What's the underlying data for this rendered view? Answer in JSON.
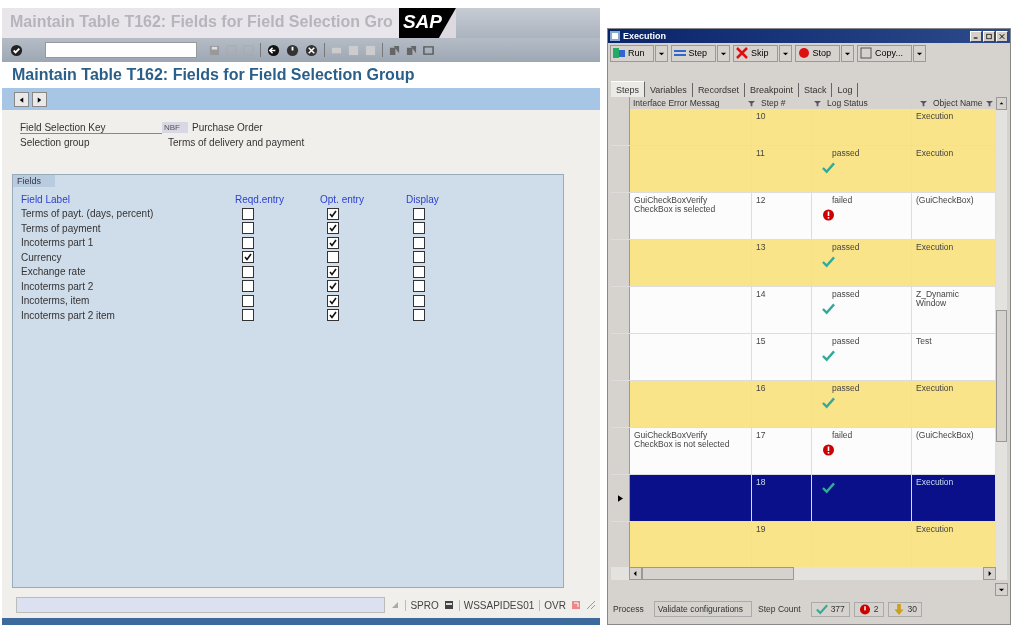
{
  "sap_window": {
    "title": "Maintain Table T162: Fields for Field Selection Gro",
    "logo": "SAP",
    "heading": "Maintain Table T162: Fields for Field Selection Group",
    "key_fields": [
      {
        "label": "Field Selection Key",
        "code": "NBF",
        "value": "Purchase Order"
      },
      {
        "label": "Selection group",
        "value": "Terms of delivery and payment"
      }
    ],
    "group_title": "Fields",
    "columns": [
      "Field Label",
      "Reqd.entry",
      "Opt. entry",
      "Display"
    ],
    "rows": [
      {
        "label": "Terms of payt. (days, percent)",
        "required": false,
        "optional": true,
        "display": false
      },
      {
        "label": "Terms of payment",
        "required": false,
        "optional": true,
        "display": false
      },
      {
        "label": "Incoterms part 1",
        "required": false,
        "optional": true,
        "display": false
      },
      {
        "label": "Currency",
        "required": true,
        "optional": false,
        "display": false
      },
      {
        "label": "Exchange rate",
        "required": false,
        "optional": true,
        "display": false
      },
      {
        "label": "Incoterms part 2",
        "required": false,
        "optional": true,
        "display": false
      },
      {
        "label": "Incoterms, item",
        "required": false,
        "optional": true,
        "display": false
      },
      {
        "label": "Incoterms part 2 item",
        "required": false,
        "optional": true,
        "display": false
      }
    ],
    "status_bar": {
      "transaction": "SPRO",
      "server": "WSSAPIDES01",
      "mode": "OVR"
    }
  },
  "execution_window": {
    "title": "Execution",
    "toolbar": [
      {
        "label": "Run",
        "kind": "run"
      },
      {
        "label": "Step",
        "kind": "step"
      },
      {
        "label": "Skip",
        "kind": "skip"
      },
      {
        "label": "Stop",
        "kind": "stop"
      },
      {
        "label": "Copy...",
        "kind": "copy"
      }
    ],
    "tabs": [
      {
        "label": "Steps",
        "selected": true
      },
      {
        "label": "Variables",
        "selected": false
      },
      {
        "label": "Recordset",
        "selected": false
      },
      {
        "label": "Breakpoint",
        "selected": false
      },
      {
        "label": "Stack",
        "selected": false
      },
      {
        "label": "Log",
        "selected": false
      }
    ],
    "columns": [
      "Interface Error Messag",
      "Step #",
      "Log Status",
      "Object Name"
    ],
    "rows": [
      {
        "step": "10",
        "object": "Execution",
        "highlighted": true,
        "selected": false
      },
      {
        "step": "11",
        "status": "passed",
        "passed": true,
        "object": "Execution",
        "highlighted": true,
        "selected": false
      },
      {
        "message": "GuiCheckBoxVerify CheckBox is selected",
        "step": "12",
        "status": "failed",
        "passed": false,
        "object": "(GuiCheckBox)",
        "highlighted": false,
        "selected": false
      },
      {
        "step": "13",
        "status": "passed",
        "passed": true,
        "object": "Execution",
        "highlighted": true,
        "selected": false
      },
      {
        "step": "14",
        "status": "passed",
        "passed": true,
        "object": "Z_Dynamic Window",
        "highlighted": false,
        "selected": false
      },
      {
        "step": "15",
        "status": "passed",
        "passed": true,
        "object": "Test",
        "highlighted": false,
        "selected": false
      },
      {
        "step": "16",
        "status": "passed",
        "passed": true,
        "object": "Execution",
        "highlighted": true,
        "selected": false
      },
      {
        "message": "GuiCheckBoxVerify CheckBox is not selected",
        "step": "17",
        "status": "failed",
        "passed": false,
        "object": "(GuiCheckBox)",
        "highlighted": false,
        "selected": false
      },
      {
        "step": "18",
        "passed": true,
        "object": "Execution",
        "highlighted": false,
        "selected": true
      },
      {
        "step": "19",
        "object": "Execution",
        "highlighted": true,
        "selected": false
      }
    ],
    "status_bar": {
      "process_label": "Process",
      "process": "Validate configurations",
      "count_label": "Step Count",
      "passed": "377",
      "failed": "2",
      "warnings": "30"
    }
  }
}
